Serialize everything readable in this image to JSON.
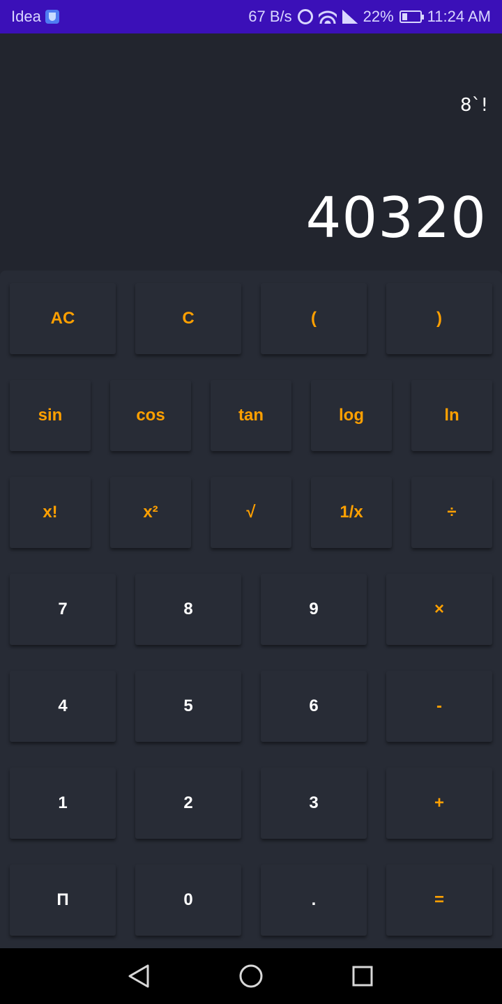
{
  "status_bar": {
    "carrier": "Idea",
    "net_speed": "67 B/s",
    "battery": "22%",
    "time": "11:24 AM"
  },
  "display": {
    "expression": "8`!",
    "result": "40320"
  },
  "colors": {
    "operator": "#ffa000",
    "digit": "#ffffff",
    "status_bar": "#3b10b8"
  },
  "keypad": {
    "row1": [
      "AC",
      "C",
      "(",
      ")"
    ],
    "row2": [
      "sin",
      "cos",
      "tan",
      "log",
      "ln"
    ],
    "row3": [
      "x!",
      "x²",
      "√",
      "1/x",
      "÷"
    ],
    "row4": [
      "7",
      "8",
      "9",
      "×"
    ],
    "row5": [
      "4",
      "5",
      "6",
      "-"
    ],
    "row6": [
      "1",
      "2",
      "3",
      "+"
    ],
    "row7": [
      "Π",
      "0",
      ".",
      "="
    ]
  },
  "nav": {
    "icons": [
      "back-icon",
      "home-icon",
      "recents-icon"
    ]
  }
}
